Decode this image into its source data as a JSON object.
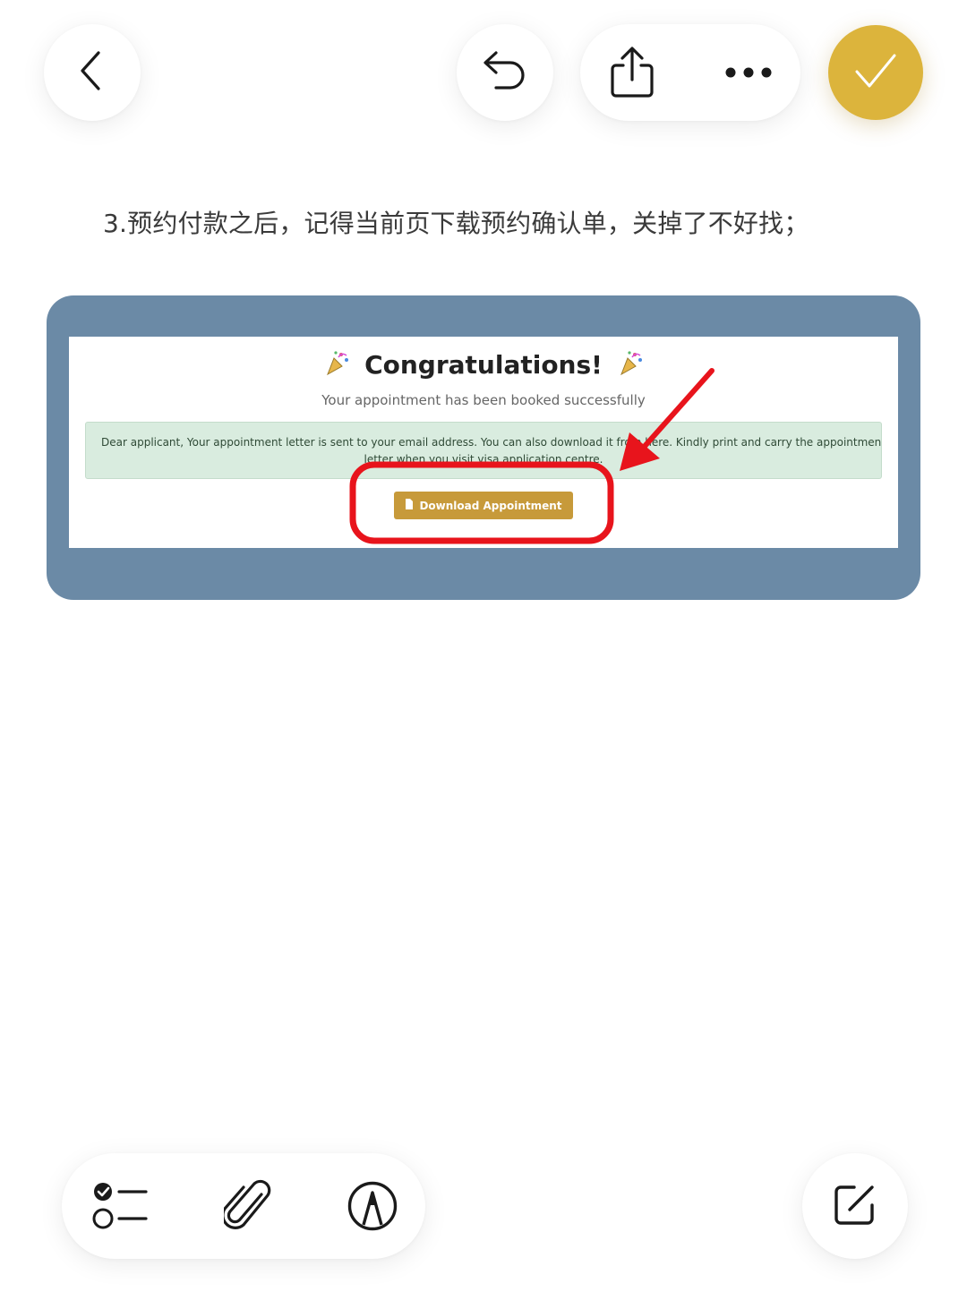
{
  "toolbar": {
    "back_icon": "chevron-left-icon",
    "undo_icon": "undo-icon",
    "share_icon": "share-icon",
    "more_icon": "more-horizontal-icon",
    "done_icon": "checkmark-icon",
    "done_color": "#dcb43c"
  },
  "note": {
    "text": "3.预约付款之后，记得当前页下载预约确认单，关掉了不好找；"
  },
  "attachment": {
    "frame_color": "#6b8aa6",
    "screenshot": {
      "title": "Congratulations!",
      "subtitle": "Your appointment has been booked successfully",
      "alert_line1": "Dear applicant, Your appointment letter is sent to your email address. You can also download it from here. Kindly print and carry the appointment",
      "alert_line2": "letter when you visit visa application centre.",
      "download_label": "Download Appointment",
      "highlight_color": "#e8141c",
      "alert_bg": "#d9ecdf",
      "button_color": "#c79a3a"
    }
  },
  "bottom_bar": {
    "checklist_icon": "checklist-icon",
    "attach_icon": "paperclip-icon",
    "markup_icon": "markup-pen-icon",
    "compose_icon": "compose-icon"
  }
}
